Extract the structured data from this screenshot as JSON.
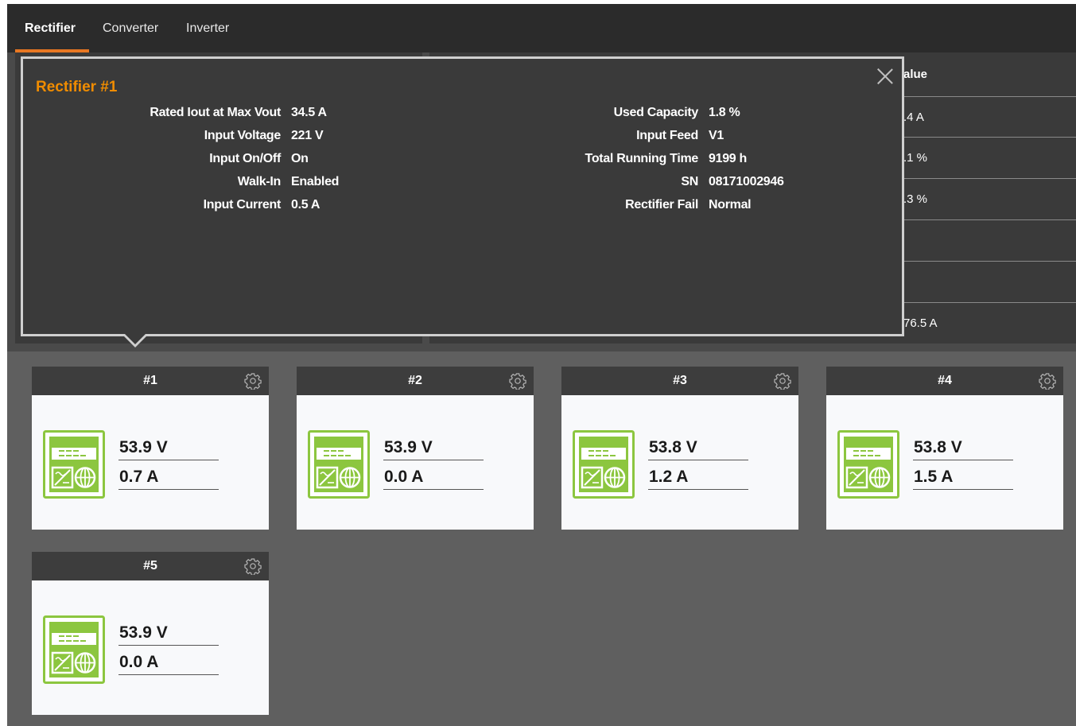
{
  "tabs": [
    {
      "label": "Rectifier",
      "active": true
    },
    {
      "label": "Converter",
      "active": false
    },
    {
      "label": "Inverter",
      "active": false
    }
  ],
  "background_table": {
    "header_fragment": "alue",
    "cells": [
      ".4 A",
      ".1 %",
      ".3 %",
      "",
      "",
      "76.5 A"
    ]
  },
  "popup": {
    "title": "Rectifier #1",
    "left_fields": [
      {
        "label": "Rated Iout at Max Vout",
        "value": "34.5 A"
      },
      {
        "label": "Input Voltage",
        "value": "221 V"
      },
      {
        "label": "Input On/Off",
        "value": "On"
      },
      {
        "label": "Walk-In",
        "value": "Enabled"
      },
      {
        "label": "Input Current",
        "value": "0.5 A"
      }
    ],
    "right_fields": [
      {
        "label": "Used Capacity",
        "value": "1.8 %"
      },
      {
        "label": "Input Feed",
        "value": "V1"
      },
      {
        "label": "Total Running Time",
        "value": "9199 h"
      },
      {
        "label": "SN",
        "value": "08171002946"
      },
      {
        "label": "Rectifier Fail",
        "value": "Normal"
      }
    ]
  },
  "rectifiers": [
    {
      "title": "#1",
      "voltage": "53.9 V",
      "current": "0.7 A"
    },
    {
      "title": "#2",
      "voltage": "53.9 V",
      "current": "0.0 A"
    },
    {
      "title": "#3",
      "voltage": "53.8 V",
      "current": "1.2 A"
    },
    {
      "title": "#4",
      "voltage": "53.8 V",
      "current": "1.5 A"
    },
    {
      "title": "#5",
      "voltage": "53.9 V",
      "current": "0.0 A"
    }
  ],
  "colors": {
    "accent": "#e87722",
    "popup_title": "#f08c00",
    "icon_green": "#8cc63f",
    "tab_bar": "#2b2b2b",
    "page_bg": "#5f5f5f"
  }
}
